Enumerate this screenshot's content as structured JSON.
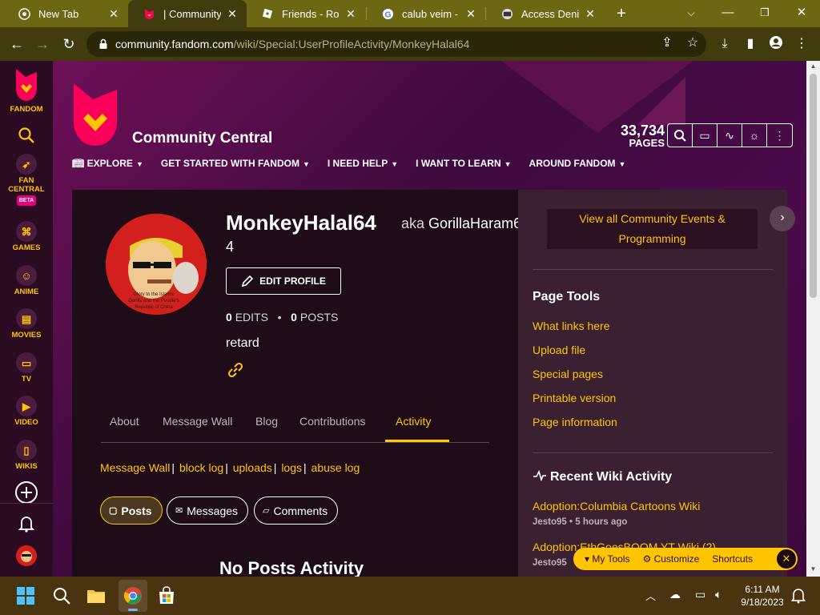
{
  "browser": {
    "tabs": [
      {
        "title": "New Tab",
        "active": false,
        "icon": "chrome-icon"
      },
      {
        "title": "| Community Ce",
        "active": true,
        "icon": "fandom-icon"
      },
      {
        "title": "Friends - Roblox",
        "active": false,
        "icon": "roblox-icon"
      },
      {
        "title": "calub veim - Go",
        "active": false,
        "icon": "google-icon"
      },
      {
        "title": "Access Denied",
        "active": false,
        "icon": "globe-icon"
      }
    ],
    "new_tab": "+",
    "url_host": "community.fandom.com",
    "url_path": "/wiki/Special:UserProfileActivity/MonkeyHalal64"
  },
  "global_nav": {
    "logo_label": "FANDOM",
    "items": [
      {
        "label": "FAN",
        "label2": "CENTRAL",
        "badge": "BETA",
        "icon": "rocket-icon"
      },
      {
        "label": "GAMES",
        "icon": "gamepad-icon"
      },
      {
        "label": "ANIME",
        "icon": "anime-icon"
      },
      {
        "label": "MOVIES",
        "icon": "clapperboard-icon"
      },
      {
        "label": "TV",
        "icon": "tv-icon"
      },
      {
        "label": "VIDEO",
        "icon": "play-icon"
      },
      {
        "label": "WIKIS",
        "icon": "book-icon"
      }
    ]
  },
  "community": {
    "name": "Community Central",
    "page_count": "33,734",
    "page_count_label": "PAGES",
    "menu": [
      "EXPLORE",
      "GET STARTED WITH FANDOM",
      "I NEED HELP",
      "I WANT TO LEARN",
      "AROUND FANDOM"
    ]
  },
  "profile": {
    "username": "MonkeyHalal64",
    "aka_prefix": "aka",
    "aka_value": "GorillaHaram6",
    "aka_value_wrap": "4",
    "edit_button": "EDIT PROFILE",
    "edits_count": "0",
    "edits_label": "EDITS",
    "stats_sep": "•",
    "posts_count": "0",
    "posts_label": "POSTS",
    "bio": "retard",
    "tabs": [
      "About",
      "Message Wall",
      "Blog",
      "Contributions",
      "Activity"
    ],
    "active_tab": "Activity",
    "sub_links": [
      "Message Wall",
      "block log",
      "uploads",
      "logs",
      "abuse log"
    ],
    "filters": [
      "Posts",
      "Messages",
      "Comments"
    ],
    "active_filter": "Posts",
    "empty_text": "No Posts Activity"
  },
  "rail": {
    "event_line1": "View all Community Events &",
    "event_line2": "Programming",
    "page_tools_title": "Page Tools",
    "page_tools": [
      "What links here",
      "Upload file",
      "Special pages",
      "Printable version",
      "Page information"
    ],
    "recent_title": "Recent Wiki Activity",
    "recent": [
      {
        "title": "Adoption:Columbia Cartoons Wiki",
        "meta": "Jesto95 • 5 hours ago"
      },
      {
        "title": "Adoption:EthGoesBOOM YT Wiki (2)",
        "meta": "Jesto95"
      }
    ]
  },
  "my_tools": {
    "my_tools": "My Tools",
    "customize": "Customize",
    "shortcuts": "Shortcuts"
  },
  "taskbar": {
    "time": "6:11 AM",
    "date": "9/18/2023"
  },
  "colors": {
    "accent": "#ffc500",
    "page_bg": "#3d0b3d",
    "article_bg": "#1e0d19",
    "rail_bg": "#3a2030",
    "chrome_frame": "#6b6712"
  }
}
